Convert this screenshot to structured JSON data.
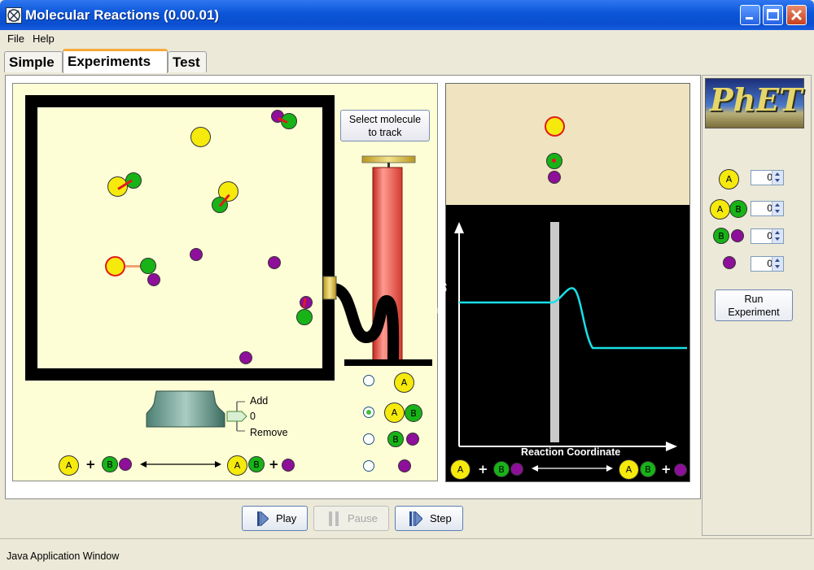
{
  "window": {
    "title": "Molecular Reactions (0.00.01)"
  },
  "menu": {
    "file": "File",
    "help": "Help"
  },
  "tabs": [
    {
      "label": "Simple"
    },
    {
      "label": "Experiments"
    },
    {
      "label": "Test"
    }
  ],
  "simulation": {
    "select_button_line1": "Select molecule",
    "select_button_line2": "to track",
    "slider": {
      "add_label": "Add",
      "value": "0",
      "remove_label": "Remove"
    },
    "molecule_options": [
      {
        "label": "A",
        "selected": false
      },
      {
        "label": "AB",
        "selected": true
      },
      {
        "label": "BC",
        "selected": false
      },
      {
        "label": "C",
        "selected": false
      }
    ],
    "reaction": {
      "a": "A",
      "b": "B",
      "plus": "+"
    }
  },
  "energy_diagram": {
    "ylabel": "Energy",
    "xlabel": "Reaction Coordinate",
    "reaction": {
      "a": "A",
      "b": "B",
      "plus": "+"
    }
  },
  "experiment_panel": {
    "logo_text": "PhET",
    "counts": [
      {
        "molecule": "A",
        "value": "0"
      },
      {
        "molecule": "AB",
        "value": "0"
      },
      {
        "molecule": "BC",
        "value": "0"
      },
      {
        "molecule": "C",
        "value": "0"
      }
    ],
    "run_button_line1": "Run",
    "run_button_line2": "Experiment"
  },
  "controls": {
    "play": "Play",
    "pause": "Pause",
    "step": "Step"
  },
  "status": {
    "text": "Java Application Window"
  },
  "colors": {
    "molecule_a": "#f5ea0c",
    "molecule_b": "#17b317",
    "molecule_c": "#8e0f9a",
    "bond": "#e11b1b",
    "energy_curve": "#19e0e8"
  }
}
